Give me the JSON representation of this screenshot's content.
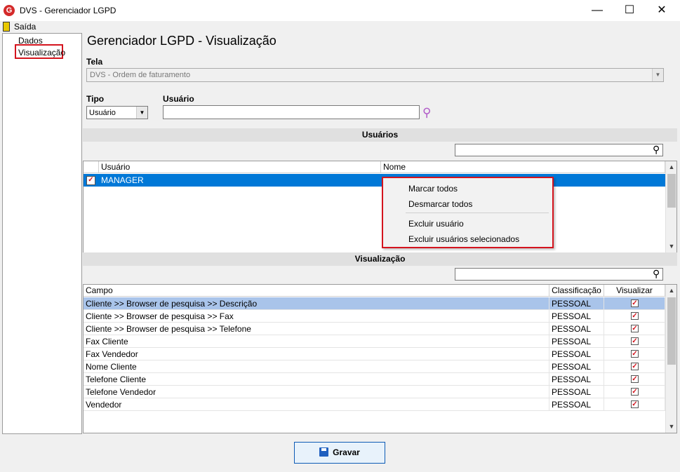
{
  "window": {
    "title": "DVS - Gerenciador LGPD",
    "app_icon": "G"
  },
  "menu": {
    "exit_label": "Saída"
  },
  "tree": {
    "items": [
      "Dados",
      "Visualização"
    ]
  },
  "main": {
    "title": "Gerenciador LGPD - Visualização",
    "tela_label": "Tela",
    "tela_value": "DVS - Ordem de faturamento",
    "tipo_label": "Tipo",
    "tipo_value": "Usuário",
    "usuario_label": "Usuário",
    "usuario_value": ""
  },
  "users_section": {
    "header": "Usuários",
    "columns": [
      "Usuário",
      "Nome"
    ],
    "rows": [
      {
        "usuario": "MANAGER",
        "nome": "",
        "checked": true
      }
    ]
  },
  "context_menu": {
    "items": [
      "Marcar todos",
      "Desmarcar todos",
      "Excluir usuário",
      "Excluir usuários selecionados"
    ]
  },
  "vis_section": {
    "header": "Visualização",
    "columns": [
      "Campo",
      "Classificação",
      "Visualizar"
    ],
    "rows": [
      {
        "campo": "Cliente >> Browser de pesquisa >> Descrição",
        "classificacao": "PESSOAL",
        "visualizar": true
      },
      {
        "campo": "Cliente >> Browser de pesquisa >> Fax",
        "classificacao": "PESSOAL",
        "visualizar": true
      },
      {
        "campo": "Cliente >> Browser de pesquisa >> Telefone",
        "classificacao": "PESSOAL",
        "visualizar": true
      },
      {
        "campo": "Fax Cliente",
        "classificacao": "PESSOAL",
        "visualizar": true
      },
      {
        "campo": "Fax Vendedor",
        "classificacao": "PESSOAL",
        "visualizar": true
      },
      {
        "campo": "Nome Cliente",
        "classificacao": "PESSOAL",
        "visualizar": true
      },
      {
        "campo": "Telefone Cliente",
        "classificacao": "PESSOAL",
        "visualizar": true
      },
      {
        "campo": "Telefone Vendedor",
        "classificacao": "PESSOAL",
        "visualizar": true
      },
      {
        "campo": "Vendedor",
        "classificacao": "PESSOAL",
        "visualizar": true
      }
    ]
  },
  "footer": {
    "save_label": "Gravar"
  },
  "colors": {
    "accent": "#0078d7",
    "selected_row": "#0078d7",
    "highlight_border": "#d4141e",
    "check": "#d4141e"
  }
}
